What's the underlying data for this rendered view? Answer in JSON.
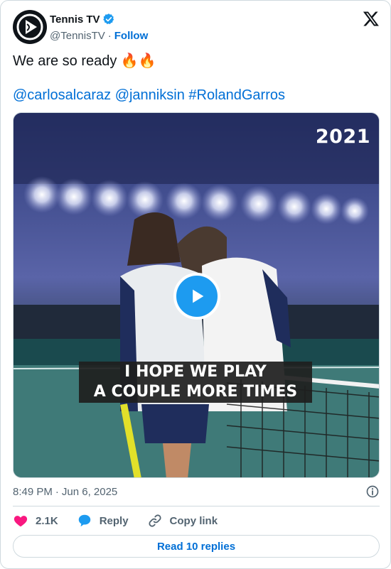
{
  "author": {
    "display_name": "Tennis TV",
    "handle": "@TennisTV",
    "separator": "·",
    "follow_label": "Follow"
  },
  "tweet": {
    "text": "We are so ready 🔥🔥",
    "mentions": [
      "@carlosalcaraz",
      "@janniksin",
      "#RolandGarros"
    ]
  },
  "media": {
    "overlay_year": "2021",
    "caption_line1": "I HOPE WE PLAY",
    "caption_line2": "A COUPLE MORE TIMES"
  },
  "meta": {
    "time": "8:49 PM",
    "separator": "·",
    "date": "Jun 6, 2025"
  },
  "actions": {
    "likes": "2.1K",
    "reply_label": "Reply",
    "copy_label": "Copy link"
  },
  "read_replies_label": "Read 10 replies",
  "colors": {
    "link": "#006fd6",
    "like": "#f91880",
    "play": "#1d9bf0",
    "verified": "#1d9bf0"
  },
  "icons": [
    "tennis-tv-logo",
    "verified-icon",
    "x-logo-icon",
    "play-icon",
    "info-icon",
    "heart-icon",
    "reply-bubble-icon",
    "link-icon"
  ]
}
